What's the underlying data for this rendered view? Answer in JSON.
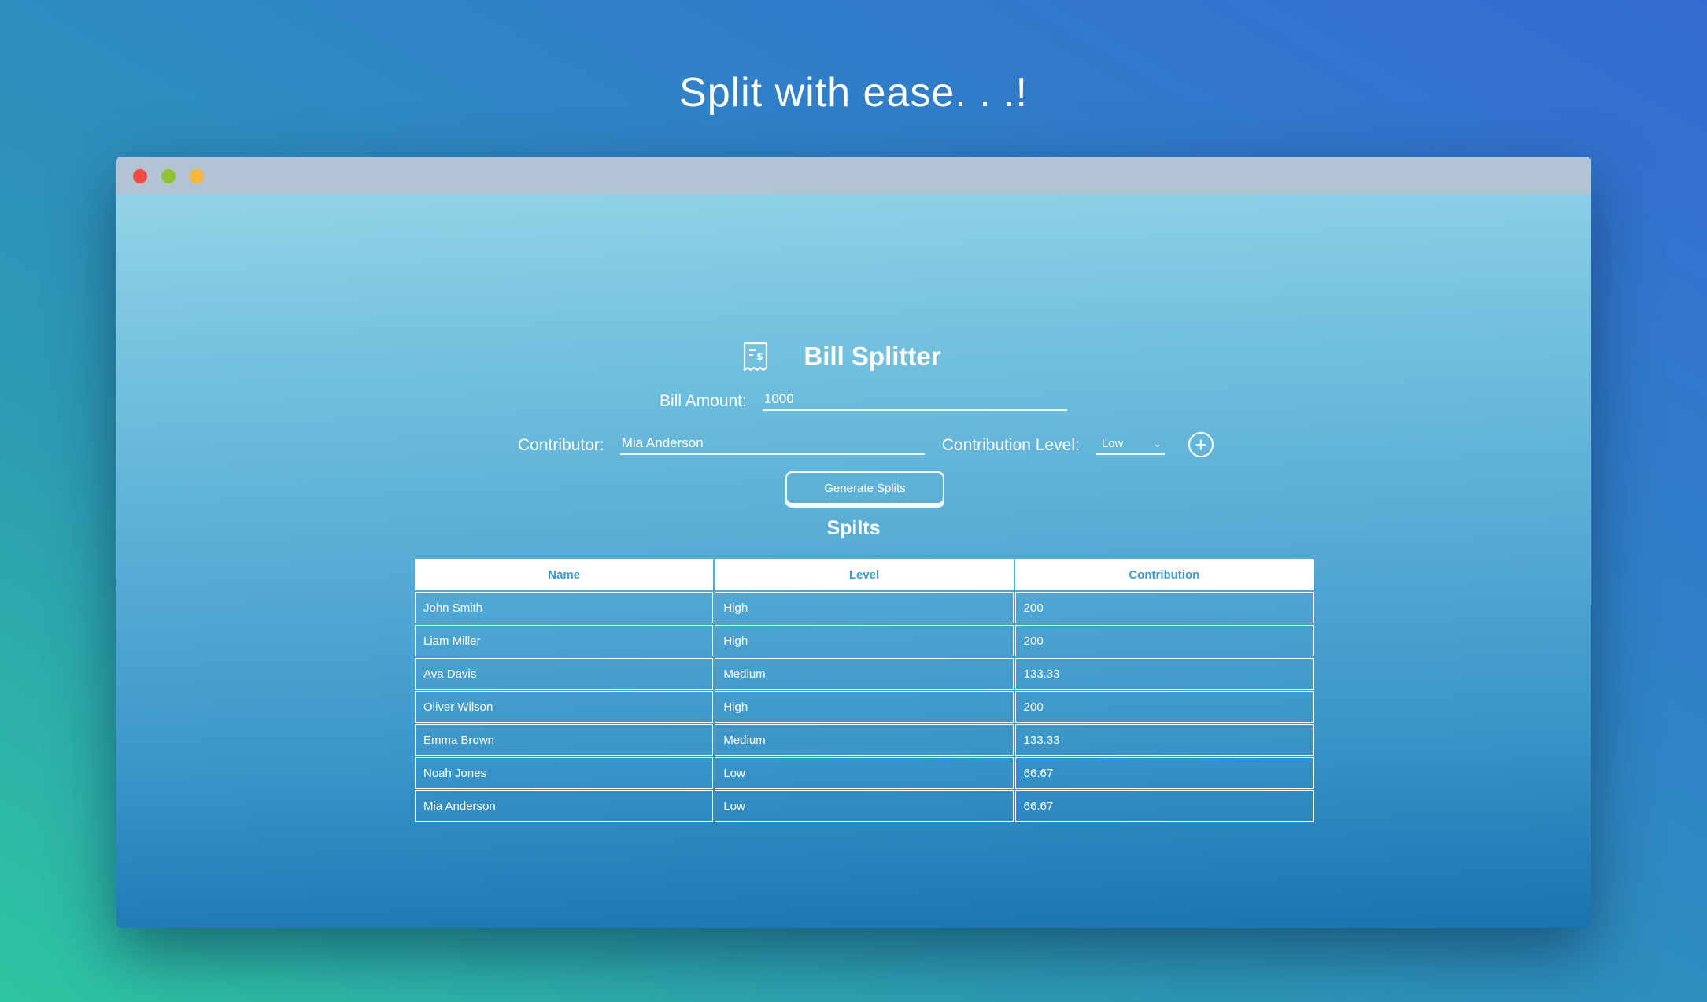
{
  "hero": {
    "title": "Split with ease. . .!"
  },
  "app": {
    "title": "Bill Splitter",
    "icon": "receipt-icon",
    "bill_amount": {
      "label": "Bill Amount:",
      "value": "1000"
    },
    "contributor": {
      "label": "Contributor:",
      "value": "Mia Anderson"
    },
    "contribution_level": {
      "label": "Contribution Level:",
      "value": "Low"
    },
    "add_button": {
      "icon": "plus-circle-icon",
      "label": "+"
    },
    "generate_button": {
      "label": "Generate Splits"
    },
    "splits_heading": "Spilts",
    "table": {
      "headers": [
        "Name",
        "Level",
        "Contribution"
      ],
      "rows": [
        [
          "John Smith",
          "High",
          "200"
        ],
        [
          "Liam Miller",
          "High",
          "200"
        ],
        [
          "Ava Davis",
          "Medium",
          "133.33"
        ],
        [
          "Oliver Wilson",
          "High",
          "200"
        ],
        [
          "Emma Brown",
          "Medium",
          "133.33"
        ],
        [
          "Noah Jones",
          "Low",
          "66.67"
        ],
        [
          "Mia Anderson",
          "Low",
          "66.67"
        ]
      ]
    }
  },
  "colors": {
    "window_dot_close": "#f24b43",
    "window_dot_zoom": "#8ec23a",
    "window_dot_minimize": "#f7b63e",
    "header_text": "#3a9bd0"
  }
}
